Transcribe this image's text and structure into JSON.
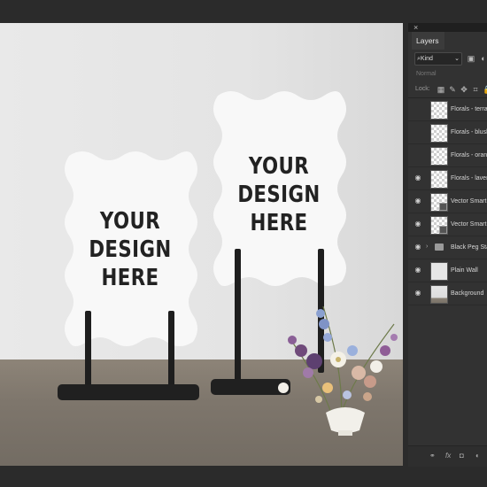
{
  "panel": {
    "close_glyph": "×",
    "tab": "Layers",
    "filter_kind": "Kind",
    "blend_mode": "Normal",
    "lock_label": "Lock:"
  },
  "signs": {
    "left_text": [
      "YOUR",
      "DESIGN",
      "HERE"
    ],
    "right_text": [
      "YOUR",
      "DESIGN",
      "HERE"
    ]
  },
  "layers": [
    {
      "name": "Florals - terra",
      "visible": false,
      "thumb": "checker"
    },
    {
      "name": "Florals - blush",
      "visible": false,
      "thumb": "checker"
    },
    {
      "name": "Florals - orang",
      "visible": false,
      "thumb": "checker"
    },
    {
      "name": "Florals - laven",
      "visible": true,
      "thumb": "checker"
    },
    {
      "name": "Vector Smart",
      "visible": true,
      "thumb": "smart"
    },
    {
      "name": "Vector Smart",
      "visible": true,
      "thumb": "smart"
    },
    {
      "name": "Black Peg Sta",
      "visible": true,
      "thumb": "folder"
    },
    {
      "name": "Plain Wall",
      "visible": true,
      "thumb": "plain"
    },
    {
      "name": "Background",
      "visible": true,
      "thumb": "photo"
    }
  ],
  "icons": {
    "footer": [
      "link-icon",
      "fx-icon",
      "mask-icon",
      "adjustment-icon"
    ]
  }
}
